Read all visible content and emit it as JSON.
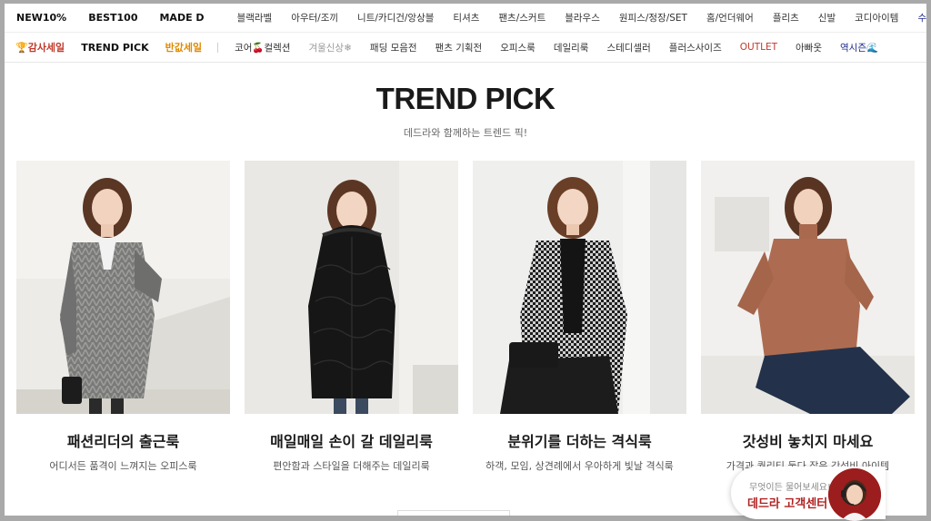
{
  "nav_primary": {
    "main": [
      "NEW10%",
      "BEST100",
      "MADE D"
    ],
    "categories": [
      "블랙라벨",
      "아우터/조끼",
      "니트/카디건/앙상블",
      "티셔츠",
      "팬츠/스커트",
      "블라우스",
      "원피스/정장/SET",
      "홈/언더웨어",
      "플리츠",
      "신발",
      "코디아이템",
      "수영복"
    ]
  },
  "nav_secondary": {
    "main": [
      "🏆감사세일",
      "TREND PICK",
      "반값세일"
    ],
    "categories": [
      "코어🍒컬렉션",
      "겨울신상❄",
      "패딩 모음전",
      "팬츠 기획전",
      "오피스룩",
      "데일리룩",
      "스테디셀러",
      "플러스사이즈",
      "OUTLET",
      "아빠옷",
      "역시즌🌊"
    ]
  },
  "section": {
    "title": "TREND PICK",
    "subtitle": "데드라와 함께하는 트렌드 픽!"
  },
  "cards": [
    {
      "name": "패션리더의 출근룩",
      "desc": "어디서든 품격이 느껴지는 오피스룩"
    },
    {
      "name": "매일매일 손이 갈 데일리룩",
      "desc": "편안함과 스타일을 더해주는 데일리룩"
    },
    {
      "name": "분위기를 더하는 격식룩",
      "desc": "하객, 모임, 상견례에서 우아하게 빛날 격식룩"
    },
    {
      "name": "갓성비 놓치지 마세요",
      "desc": "가격과 퀄리티 둘다 잡은 갓성비 아이템"
    }
  ],
  "customer_center": {
    "prompt": "무엇이든 물어보세요!",
    "label": "데드라 고객센터"
  },
  "colors": {
    "sale_red": "#c0392b",
    "half_sale_orange": "#e08a00",
    "swimwear_navy": "#1e2a8a",
    "outlet_red": "#c0392b",
    "muted_grey": "#9a9a9a",
    "cs_red": "#b22222"
  }
}
